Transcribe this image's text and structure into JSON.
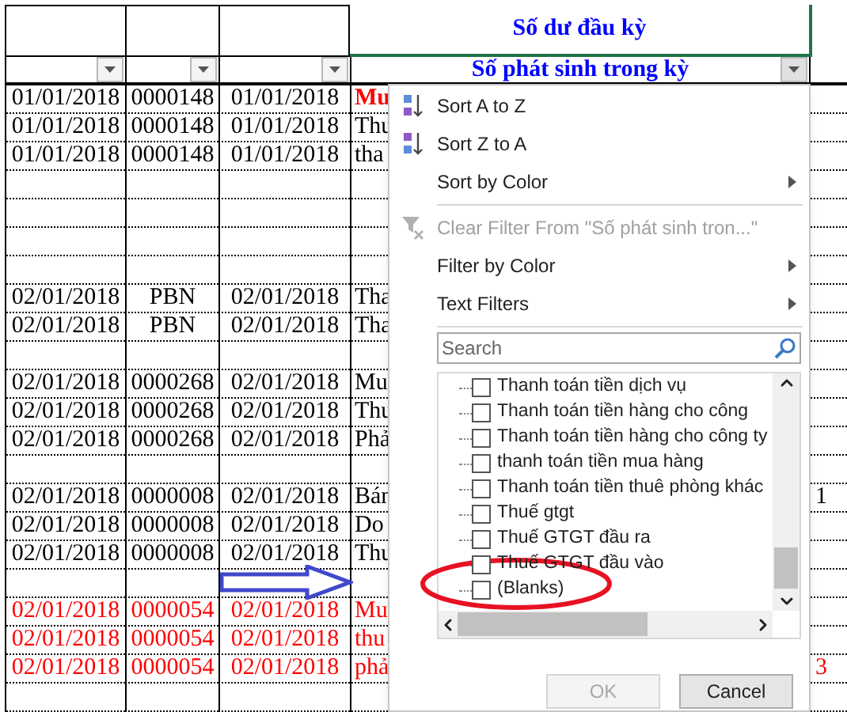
{
  "sheet": {
    "title_cell": "Số dư đầu kỳ",
    "filter_label": "Số phát sinh trong kỳ",
    "rows": [
      {
        "kind": "data",
        "red": false,
        "date": "01/01/2018",
        "voucher": "0000148",
        "posted": "01/01/2018",
        "desc": "Mu",
        "desc_bold_red": true
      },
      {
        "kind": "data",
        "red": false,
        "date": "01/01/2018",
        "voucher": "0000148",
        "posted": "01/01/2018",
        "desc": "Thu"
      },
      {
        "kind": "data",
        "red": false,
        "date": "01/01/2018",
        "voucher": "0000148",
        "posted": "01/01/2018",
        "desc": "tha"
      },
      {
        "kind": "blank"
      },
      {
        "kind": "blank"
      },
      {
        "kind": "blank"
      },
      {
        "kind": "blank"
      },
      {
        "kind": "data",
        "red": false,
        "date": "02/01/2018",
        "voucher": "PBN",
        "posted": "02/01/2018",
        "desc": "Tha"
      },
      {
        "kind": "data",
        "red": false,
        "date": "02/01/2018",
        "voucher": "PBN",
        "posted": "02/01/2018",
        "desc": "Tha"
      },
      {
        "kind": "blank"
      },
      {
        "kind": "data",
        "red": false,
        "date": "02/01/2018",
        "voucher": "0000268",
        "posted": "02/01/2018",
        "desc": "Mu"
      },
      {
        "kind": "data",
        "red": false,
        "date": "02/01/2018",
        "voucher": "0000268",
        "posted": "02/01/2018",
        "desc": "Thu"
      },
      {
        "kind": "data",
        "red": false,
        "date": "02/01/2018",
        "voucher": "0000268",
        "posted": "02/01/2018",
        "desc": "Phả"
      },
      {
        "kind": "blank"
      },
      {
        "kind": "data",
        "red": false,
        "date": "02/01/2018",
        "voucher": "0000008",
        "posted": "02/01/2018",
        "desc": "Bán",
        "col_e": "1"
      },
      {
        "kind": "data",
        "red": false,
        "date": "02/01/2018",
        "voucher": "0000008",
        "posted": "02/01/2018",
        "desc": "Do"
      },
      {
        "kind": "data",
        "red": false,
        "date": "02/01/2018",
        "voucher": "0000008",
        "posted": "02/01/2018",
        "desc": "Thu"
      },
      {
        "kind": "blank"
      },
      {
        "kind": "data",
        "red": true,
        "date": "02/01/2018",
        "voucher": "0000054",
        "posted": "02/01/2018",
        "desc": "Mu"
      },
      {
        "kind": "data",
        "red": true,
        "date": "02/01/2018",
        "voucher": "0000054",
        "posted": "02/01/2018",
        "desc": "thu"
      },
      {
        "kind": "data",
        "red": true,
        "date": "02/01/2018",
        "voucher": "0000054",
        "posted": "02/01/2018",
        "desc": "phả",
        "col_e": "3"
      },
      {
        "kind": "blank"
      }
    ]
  },
  "filter_menu": {
    "items": [
      {
        "label": "Sort A to Z",
        "kind": "ascending",
        "submenu": false,
        "disabled": false
      },
      {
        "label": "Sort Z to A",
        "kind": "descending",
        "submenu": false,
        "disabled": false
      },
      {
        "label": "Sort by Color",
        "kind": "plain",
        "submenu": true,
        "disabled": false
      },
      {
        "kind": "separator"
      },
      {
        "label": "Clear Filter From \"Số phát sinh tron...\"",
        "kind": "clear",
        "submenu": false,
        "disabled": true
      },
      {
        "label": "Filter by Color",
        "kind": "plain",
        "submenu": true,
        "disabled": false
      },
      {
        "label": "Text Filters",
        "kind": "plain",
        "submenu": true,
        "disabled": false
      },
      {
        "kind": "separator"
      }
    ],
    "search": {
      "placeholder": "Search"
    },
    "values": [
      {
        "label": "Thanh toán tiền dịch vụ",
        "checked": false
      },
      {
        "label": "Thanh toán tiền hàng cho công",
        "checked": false
      },
      {
        "label": "Thanh toán tiền hàng cho công ty",
        "checked": false
      },
      {
        "label": "thanh toán tiền mua hàng",
        "checked": false
      },
      {
        "label": "Thanh toán tiền thuê phòng khác",
        "checked": false
      },
      {
        "label": "Thuế gtgt",
        "checked": false
      },
      {
        "label": "Thuế GTGT đầu ra",
        "checked": false
      },
      {
        "label": "Thuế GTGT đầu vào",
        "checked": false
      },
      {
        "label": "(Blanks)",
        "checked": false
      }
    ],
    "buttons": [
      {
        "label": "OK",
        "disabled": true
      },
      {
        "label": "Cancel",
        "disabled": false
      }
    ]
  }
}
